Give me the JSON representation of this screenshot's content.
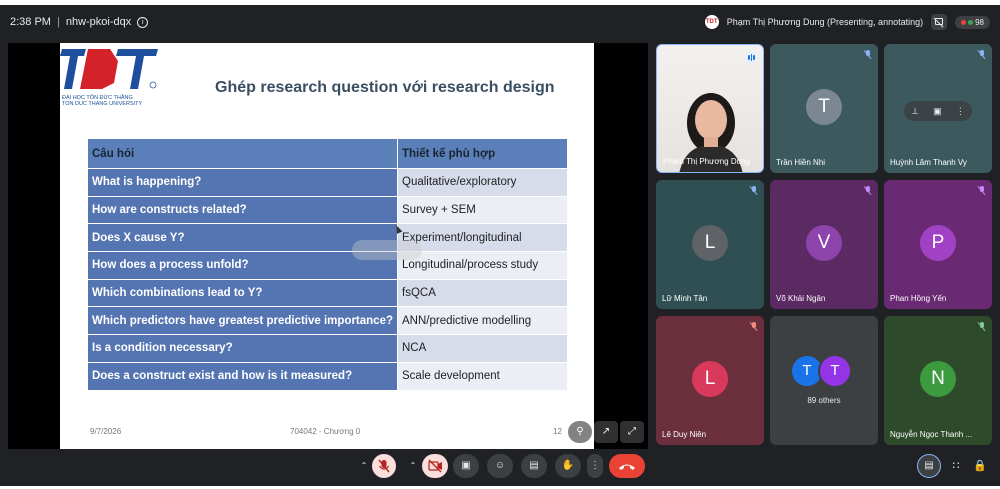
{
  "topbar": {
    "time": "2:38 PM",
    "separator": "|",
    "meeting_code": "nhw-pkoi-dqx",
    "presenter_label": "Phạm Thị Phương Dung (Presenting, annotating)",
    "participant_count": "98"
  },
  "slide": {
    "logo_text": "TĐT",
    "logo_line1": "ĐẠI HỌC TÔN ĐỨC THẮNG",
    "logo_line2": "TON DUC THANG UNIVERSITY",
    "title": "Ghép research question với research design",
    "headers": [
      "Câu hỏi",
      "Thiết kế phù hợp"
    ],
    "rows": [
      [
        "What is happening?",
        "Qualitative/exploratory"
      ],
      [
        "How are constructs related?",
        "Survey + SEM"
      ],
      [
        "Does X cause Y?",
        "Experiment/longitudinal"
      ],
      [
        "How does a process unfold?",
        "Longitudinal/process study"
      ],
      [
        "Which combinations lead to Y?",
        "fsQCA"
      ],
      [
        "Which predictors have greatest predictive importance?",
        "ANN/predictive modelling"
      ],
      [
        "Is a condition necessary?",
        "NCA"
      ],
      [
        "Does a construct exist and how is it measured?",
        "Scale development"
      ]
    ],
    "footer_date": "9/7/2026",
    "footer_center": "704042 - Chương 0",
    "footer_page": "12"
  },
  "participants": [
    {
      "name": "Phạm Thị Phương Dung",
      "initial": "",
      "color": "",
      "status": "speaking"
    },
    {
      "name": "Trần Hiền Nhi",
      "initial": "T",
      "color": "#7b8791",
      "status": "muted"
    },
    {
      "name": "Huỳnh Lâm Thanh Vy",
      "initial": "",
      "color": "",
      "status": "muted"
    },
    {
      "name": "Lữ Minh Tân",
      "initial": "L",
      "color": "#5f6368",
      "status": "muted"
    },
    {
      "name": "Võ Khải Ngân",
      "initial": "V",
      "color": "#8e44ad",
      "status": "muted"
    },
    {
      "name": "Phan Hồng Yến",
      "initial": "P",
      "color": "#a142c4",
      "status": "muted"
    },
    {
      "name": "Lê Duy Niên",
      "initial": "L",
      "color": "#d93a5b",
      "status": "muted"
    },
    {
      "name": "Nguyễn Ngọc Thanh ...",
      "initial": "N",
      "color": "#3d9b3f",
      "status": "muted"
    }
  ],
  "others": {
    "label": "89 others",
    "initial1": "T",
    "initial2": "T"
  },
  "colors": {
    "accent": "#8ab4f8",
    "end_call": "#ea4335",
    "tile_bg": "#2f4f52"
  }
}
